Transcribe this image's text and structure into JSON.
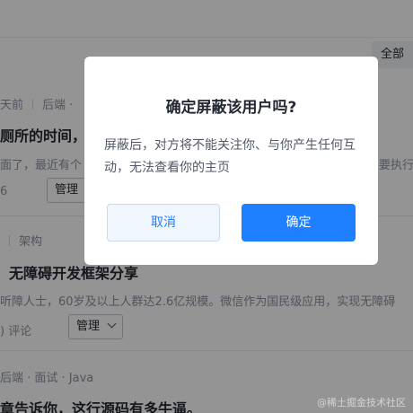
{
  "filter": {
    "all_label": "全部"
  },
  "articles": [
    {
      "time": "天前",
      "tags": "后端 · ",
      "title": "厕所的时间，",
      "abstract": "面了，最近有个",
      "abstract_right": "要执行",
      "count": "6",
      "manage_label": "管理"
    },
    {
      "tag": "架构",
      "title": "无障碍开发框架分享",
      "abstract": "听障人士，60岁及以上人群达2.6亿规模。微信作为国民级应用，实现无障碍",
      "count": ") 评论",
      "manage_label": "管理"
    },
    {
      "tags": "后端 · 面试 · Java",
      "title": "章告诉你，这行源码有多牛逼。"
    }
  ],
  "modal": {
    "title": "确定屏蔽该用户吗?",
    "body": "屏蔽后，对方将不能关注你、与你产生任何互动，无法查看你的主页",
    "cancel_label": "取消",
    "confirm_label": "确定"
  },
  "watermark": "@稀土掘金技术社区"
}
